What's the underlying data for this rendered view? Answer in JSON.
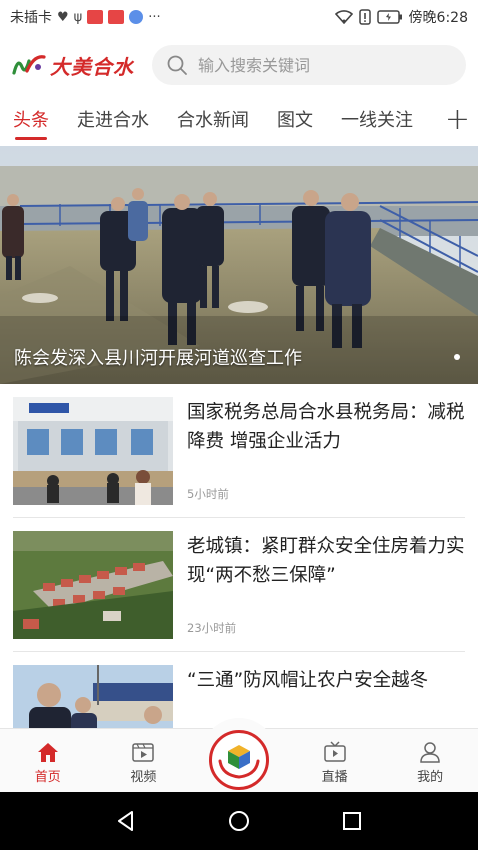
{
  "status_bar": {
    "carrier": "未插卡",
    "time": "傍晚6:28"
  },
  "header": {
    "logo_text": "大美合水",
    "search_placeholder": "输入搜索关键词"
  },
  "tabs": [
    {
      "label": "头条",
      "active": true
    },
    {
      "label": "走进合水",
      "active": false
    },
    {
      "label": "合水新闻",
      "active": false
    },
    {
      "label": "图文",
      "active": false
    },
    {
      "label": "一线关注",
      "active": false
    }
  ],
  "tab_add_label": "+",
  "banner": {
    "caption": "陈会发深入县川河开展河道巡查工作"
  },
  "news": [
    {
      "title": "国家税务总局合水县税务局：减税降费 增强企业活力",
      "time": "5小时前"
    },
    {
      "title": "老城镇：紧盯群众安全住房着力实现“两不愁三保障”",
      "time": "23小时前"
    },
    {
      "title": "“三通”防风帽让农户安全越冬",
      "time": ""
    }
  ],
  "bottom_nav": [
    {
      "label": "首页",
      "icon": "home-icon",
      "active": true
    },
    {
      "label": "视频",
      "icon": "video-icon",
      "active": false
    },
    {
      "label": "直播",
      "icon": "live-icon",
      "active": false
    },
    {
      "label": "我的",
      "icon": "user-icon",
      "active": false
    }
  ],
  "colors": {
    "accent": "#d42a2a",
    "text": "#222222",
    "muted": "#999999"
  }
}
